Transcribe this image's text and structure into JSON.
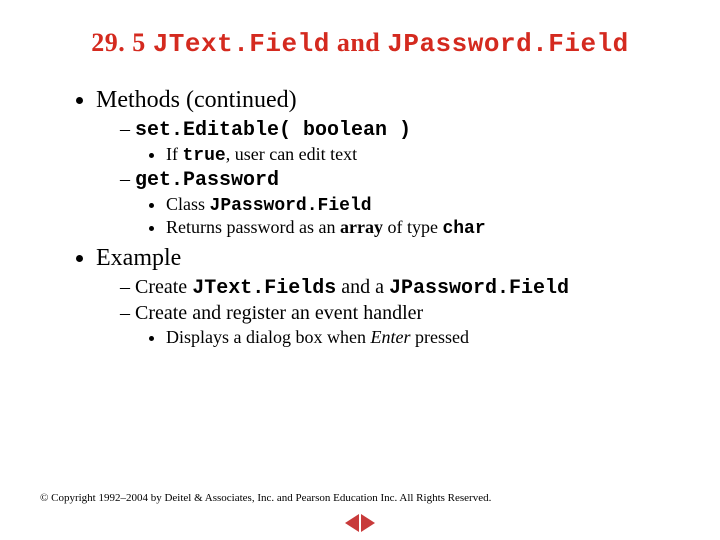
{
  "title": {
    "num": "29. 5",
    "part1": "JText.Field",
    "and": "and",
    "part2": "JPassword.Field"
  },
  "b1": {
    "methods": "Methods (continued)",
    "setEditable": "set.Editable( boolean )",
    "ifTrue_pre": "If ",
    "ifTrue_code": "true",
    "ifTrue_post": ", user can edit text",
    "getPassword": "get.Password",
    "class_pre": "Class ",
    "class_code": "JPassword.Field",
    "returns_pre": "Returns password as an ",
    "returns_arr": "array",
    "returns_mid": " of type ",
    "returns_char": "char"
  },
  "b2": {
    "example": "Example",
    "create_pre": "Create ",
    "create_a": "JText.Fields",
    "create_mid": " and a ",
    "create_b": "JPassword.Field",
    "register": "Create and register an event handler",
    "dialog_pre": "Displays a dialog box when ",
    "dialog_enter": "Enter",
    "dialog_post": " pressed"
  },
  "footer": "© Copyright 1992–2004 by Deitel & Associates, Inc. and Pearson Education Inc. All Rights Reserved."
}
